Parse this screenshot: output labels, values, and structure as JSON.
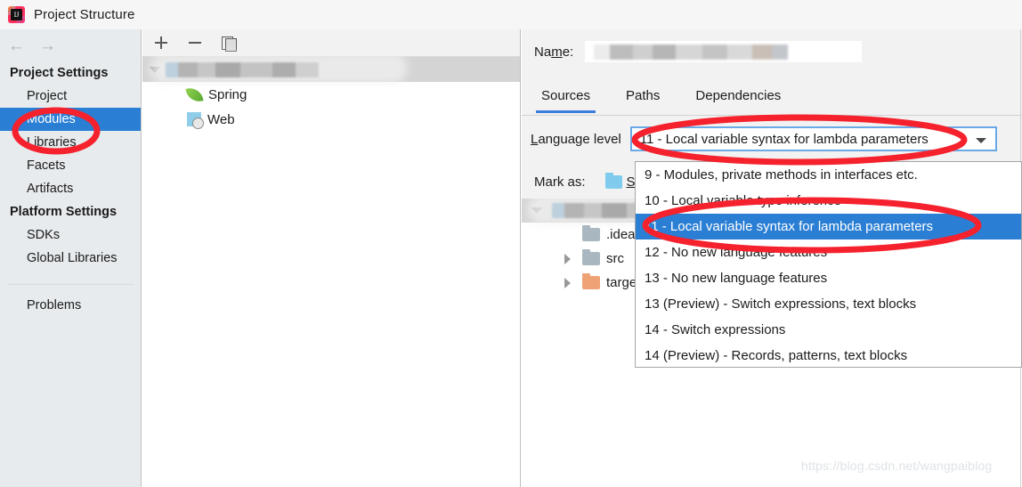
{
  "window": {
    "title": "Project Structure",
    "app_icon": "intellij-idea-logo"
  },
  "sidebar": {
    "back_icon": "←",
    "forward_icon": "→",
    "groups": [
      {
        "label": "Project Settings",
        "items": [
          {
            "label": "Project",
            "selected": false
          },
          {
            "label": "Modules",
            "selected": true
          },
          {
            "label": "Libraries",
            "selected": false
          },
          {
            "label": "Facets",
            "selected": false
          },
          {
            "label": "Artifacts",
            "selected": false
          }
        ]
      },
      {
        "label": "Platform Settings",
        "items": [
          {
            "label": "SDKs",
            "selected": false
          },
          {
            "label": "Global Libraries",
            "selected": false
          }
        ]
      }
    ],
    "problems_label": "Problems",
    "selected_color": "#2a7fd4",
    "background_color": "#e7ebed"
  },
  "module_panel": {
    "toolbar": {
      "add_label": "+",
      "remove_label": "−",
      "copy_label": "copy-icon"
    },
    "tree": {
      "root": {
        "label": "",
        "censored": true,
        "expanded": true,
        "selected": true
      },
      "children": [
        {
          "label": "Spring",
          "icon": "spring-leaf-icon"
        },
        {
          "label": "Web",
          "icon": "web-globe-icon"
        }
      ]
    }
  },
  "module_details": {
    "name_field": {
      "label_before": "Na",
      "label_mnemonic": "m",
      "label_after": "e:",
      "value": "",
      "censored": true
    },
    "tabs": [
      {
        "label": "Sources",
        "active": true
      },
      {
        "label": "Paths",
        "active": false
      },
      {
        "label": "Dependencies",
        "active": false
      }
    ],
    "language_level": {
      "label_mnemonic": "L",
      "label_rest": "anguage level",
      "selected_value": "11 - Local variable syntax for lambda parameters",
      "dropdown_arrow": "chevron-down-icon",
      "focus_border_color": "#6aa9e8"
    },
    "mark_as": {
      "label": "Mark as:",
      "option_label": "So",
      "option_icon": "blue-folder-icon"
    },
    "file_tree": [
      {
        "label": "",
        "censored": true,
        "expandable": true,
        "expanded": true,
        "selected": true,
        "indent": 0
      },
      {
        "label": ".idea",
        "icon": "gray-folder-icon",
        "expandable": false,
        "indent": 1
      },
      {
        "label": "src",
        "icon": "gray-folder-icon",
        "expandable": true,
        "indent": 1
      },
      {
        "label": "target",
        "icon": "orange-folder-icon",
        "expandable": true,
        "indent": 1
      }
    ]
  },
  "language_level_dropdown": {
    "open": true,
    "items": [
      {
        "label": "9 - Modules, private methods in interfaces etc.",
        "selected": false
      },
      {
        "label": "10 - Local variable type inference",
        "selected": false
      },
      {
        "label": "11 - Local variable syntax for lambda parameters",
        "selected": true
      },
      {
        "label": "12 - No new language features",
        "selected": false
      },
      {
        "label": "13 - No new language features",
        "selected": false
      },
      {
        "label": "13 (Preview) - Switch expressions, text blocks",
        "selected": false
      },
      {
        "label": "14 - Switch expressions",
        "selected": false
      },
      {
        "label": "14 (Preview) - Records, patterns, text blocks",
        "selected": false
      }
    ],
    "selected_color": "#2a7fd4"
  },
  "annotations": {
    "color": "#f5222d",
    "shapes": [
      "ellipse-around-modules-sidebar-item",
      "ellipse-around-language-level-combobox",
      "ellipse-around-selected-dropdown-item"
    ]
  },
  "watermark": {
    "text": "https://blog.csdn.net/wangpaiblog"
  }
}
